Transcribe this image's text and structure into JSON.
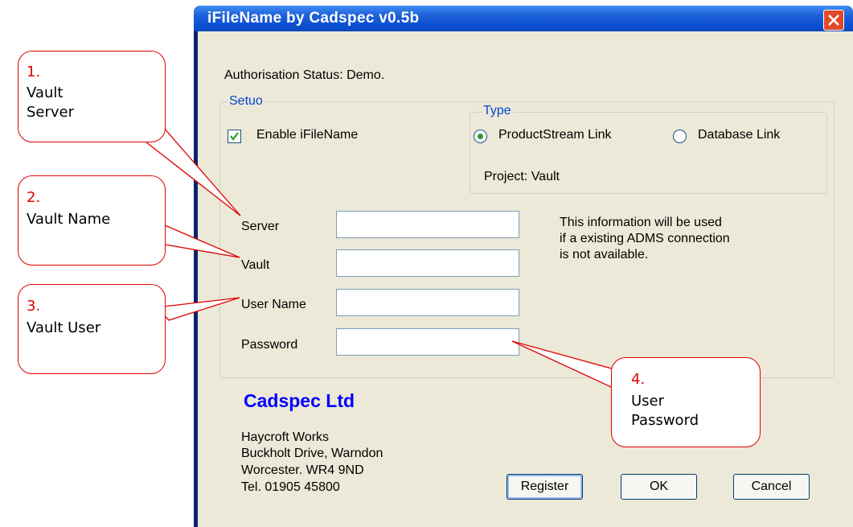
{
  "window": {
    "title": "iFileName by Cadspec v0.5b"
  },
  "status": "Authorisation Status: Demo.",
  "setup": {
    "legend": "Setuo",
    "enable_label": "Enable iFileName",
    "enable_checked": true,
    "type": {
      "legend": "Type",
      "options": [
        "ProductStream Link",
        "Database Link"
      ],
      "selected": "ProductStream Link"
    },
    "project": "Project: Vault",
    "fields": {
      "server": {
        "label": "Server",
        "value": ""
      },
      "vault": {
        "label": "Vault",
        "value": ""
      },
      "username": {
        "label": "User Name",
        "value": ""
      },
      "password": {
        "label": "Password",
        "value": ""
      }
    },
    "info_lines": [
      "This information will be used",
      "if a existing ADMS connection",
      "is not available."
    ]
  },
  "company": {
    "name": "Cadspec Ltd",
    "address_lines": [
      "Haycroft Works",
      "Buckholt Drive, Warndon",
      "Worcester. WR4 9ND",
      "Tel. 01905 45800"
    ]
  },
  "buttons": {
    "register": "Register",
    "ok": "OK",
    "cancel": "Cancel"
  },
  "callouts": [
    {
      "number": "1.",
      "lines": [
        "Vault",
        "Server"
      ]
    },
    {
      "number": "2.",
      "lines": [
        "Vault Name"
      ]
    },
    {
      "number": "3.",
      "lines": [
        "Vault User"
      ]
    },
    {
      "number": "4.",
      "lines": [
        "User",
        "Password"
      ]
    }
  ],
  "colors": {
    "callout_border": "#e00000",
    "company_text": "#0000ff",
    "legend_text": "#0046d5",
    "titlebar": "#0a4fd0"
  }
}
